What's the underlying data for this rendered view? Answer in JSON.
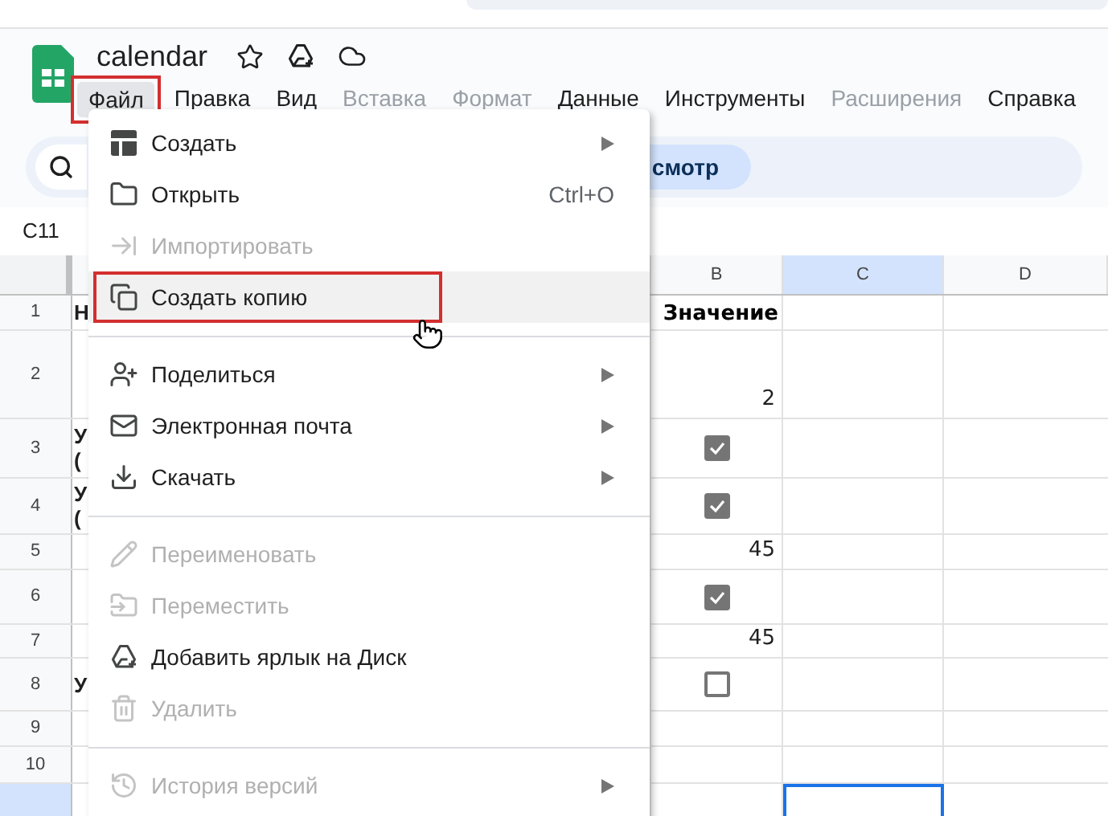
{
  "document": {
    "title": "calendar"
  },
  "menu_bar": [
    {
      "label": "Файл",
      "selected": true,
      "disabled": false,
      "highlighted": true
    },
    {
      "label": "Правка",
      "selected": false,
      "disabled": false,
      "highlighted": false
    },
    {
      "label": "Вид",
      "selected": false,
      "disabled": false,
      "highlighted": false
    },
    {
      "label": "Вставка",
      "selected": false,
      "disabled": true,
      "highlighted": false
    },
    {
      "label": "Формат",
      "selected": false,
      "disabled": true,
      "highlighted": false
    },
    {
      "label": "Данные",
      "selected": false,
      "disabled": false,
      "highlighted": false
    },
    {
      "label": "Инструменты",
      "selected": false,
      "disabled": false,
      "highlighted": false
    },
    {
      "label": "Расширения",
      "selected": false,
      "disabled": true,
      "highlighted": false
    },
    {
      "label": "Справка",
      "selected": false,
      "disabled": false,
      "highlighted": false
    }
  ],
  "toolbar": {
    "mode_button": "смотр"
  },
  "name_box": "C11",
  "sheet": {
    "columns": [
      {
        "label": "B",
        "selected": false
      },
      {
        "label": "C",
        "selected": true
      },
      {
        "label": "D",
        "selected": false
      }
    ],
    "rows": [
      {
        "number": "1",
        "selected": false,
        "column_a": "Н",
        "column_b": {
          "kind": "header",
          "text": "Значение"
        }
      },
      {
        "number": "2",
        "selected": false,
        "column_b": {
          "kind": "number",
          "text": "2"
        }
      },
      {
        "number": "3",
        "selected": false,
        "column_a": "У\n(",
        "column_b": {
          "kind": "checkbox",
          "checked": true
        }
      },
      {
        "number": "4",
        "selected": false,
        "column_a": "У\n(",
        "column_b": {
          "kind": "checkbox",
          "checked": true
        }
      },
      {
        "number": "5",
        "selected": false,
        "column_b": {
          "kind": "number",
          "text": "45"
        }
      },
      {
        "number": "6",
        "selected": false,
        "column_b": {
          "kind": "checkbox",
          "checked": true
        }
      },
      {
        "number": "7",
        "selected": false,
        "column_b": {
          "kind": "number",
          "text": "45"
        }
      },
      {
        "number": "8",
        "selected": false,
        "column_a": "У",
        "column_b": {
          "kind": "checkbox",
          "checked": false
        }
      },
      {
        "number": "9",
        "selected": false
      },
      {
        "number": "10",
        "selected": false
      },
      {
        "selected": true
      }
    ]
  },
  "file_menu": [
    {
      "kind": "item",
      "label": "Создать",
      "disabled": false,
      "submenu": true,
      "hovered": false,
      "highlighted": false
    },
    {
      "kind": "item",
      "label": "Открыть",
      "shortcut": "Ctrl+O",
      "disabled": false,
      "submenu": false,
      "hovered": false,
      "highlighted": false
    },
    {
      "kind": "item",
      "label": "Импортировать",
      "disabled": true,
      "submenu": false,
      "hovered": false,
      "highlighted": false
    },
    {
      "kind": "item",
      "label": "Создать копию",
      "disabled": false,
      "submenu": false,
      "hovered": true,
      "highlighted": true
    },
    {
      "kind": "separator"
    },
    {
      "kind": "item",
      "label": "Поделиться",
      "disabled": false,
      "submenu": true,
      "hovered": false,
      "highlighted": false
    },
    {
      "kind": "item",
      "label": "Электронная почта",
      "disabled": false,
      "submenu": true,
      "hovered": false,
      "highlighted": false
    },
    {
      "kind": "item",
      "label": "Скачать",
      "disabled": false,
      "submenu": true,
      "hovered": false,
      "highlighted": false
    },
    {
      "kind": "separator"
    },
    {
      "kind": "item",
      "label": "Переименовать",
      "disabled": true,
      "submenu": false,
      "hovered": false,
      "highlighted": false
    },
    {
      "kind": "item",
      "label": "Переместить",
      "disabled": true,
      "submenu": false,
      "hovered": false,
      "highlighted": false
    },
    {
      "kind": "item",
      "label": "Добавить ярлык на Диск",
      "disabled": false,
      "submenu": false,
      "hovered": false,
      "highlighted": false
    },
    {
      "kind": "item",
      "label": "Удалить",
      "disabled": true,
      "submenu": false,
      "hovered": false,
      "highlighted": false
    },
    {
      "kind": "separator"
    },
    {
      "kind": "item",
      "label": "История версий",
      "disabled": true,
      "submenu": true,
      "hovered": false,
      "highlighted": false
    }
  ]
}
